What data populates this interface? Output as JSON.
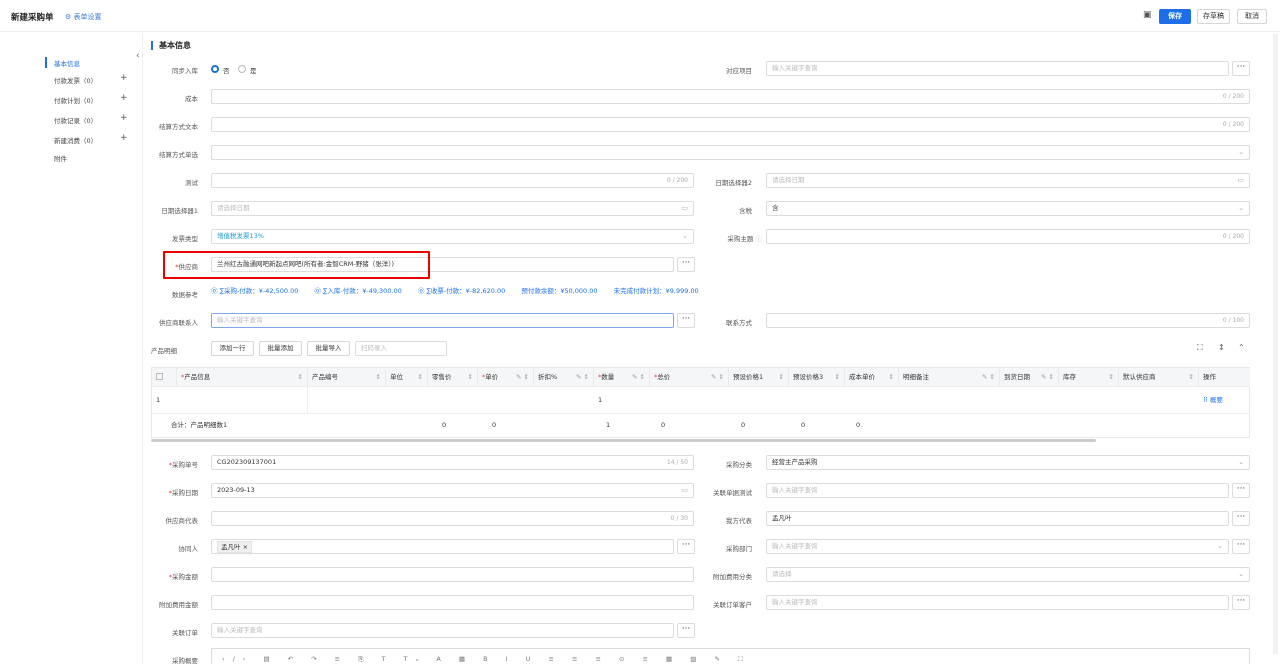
{
  "header": {
    "title": "新建采购单",
    "form_settings": "表单设置",
    "save": "保存",
    "draft": "存草稿",
    "cancel": "取消"
  },
  "sidebar": {
    "items": [
      {
        "label": "基本信息"
      },
      {
        "label": "付款发票（0）"
      },
      {
        "label": "付款计划（0）"
      },
      {
        "label": "付款记录（0）"
      },
      {
        "label": "新建消费（0）"
      },
      {
        "label": "附件"
      }
    ]
  },
  "section_title": "基本信息",
  "form": {
    "sync_label": "同步入库",
    "sync_no": "否",
    "sync_yes": "是",
    "project_label": "对应项目",
    "project_ph": "输入关键字查询",
    "cost_label": "成本",
    "cost_count": "0 / 200",
    "settle_text_label": "结算方式文本",
    "settle_text_count": "0 / 200",
    "settle_select_label": "结算方式单选",
    "test_label": "测试",
    "test_count": "0 / 200",
    "date2_label": "日期选择器2",
    "date2_ph": "请选择日期",
    "date1_label": "日期选择器1",
    "date1_ph": "请选择日期",
    "tax_label": "含税",
    "tax_value": "含",
    "invoice_label": "发票类型",
    "invoice_value": "增值税发票13%",
    "subject_label": "采购主题",
    "subject_count": "0 / 200",
    "supplier_label": "供应商",
    "supplier_value": "兰州红古融通网吧新起点网吧(所有者:金智CRM-野猪（张洋）)",
    "ref_label": "数据参考",
    "refs": [
      "⓪ ∑采购-付款：¥-42,500.00",
      "⓪ ∑入库-付款：¥-49,300.00",
      "⓪ ∑收票-付款：¥-82,620.00",
      "预付款余额：¥50,000.00",
      "未完成付款计划：¥9,999.00"
    ],
    "contact_label": "供应商联系人",
    "contact_ph": "输入关键字查询",
    "contact_way_label": "联系方式",
    "contact_way_count": "0 / 100"
  },
  "products": {
    "label": "产品明细",
    "add_row": "添加一行",
    "batch_add": "批量添加",
    "batch_import": "批量导入",
    "scan_ph": "扫码录入",
    "columns": [
      "产品信息",
      "产品编号",
      "单位",
      "零售价",
      "单价",
      "折扣%",
      "数量",
      "总价",
      "预设价格1",
      "预设价格3",
      "成本单价",
      "明细备注",
      "到货日期",
      "库存",
      "默认供应商",
      "操作"
    ],
    "row": {
      "index": "1",
      "qty": "1",
      "action": "概要"
    },
    "total": {
      "label": "合计：产品明细数1",
      "retail": "0",
      "price": "0",
      "qty": "1",
      "total": "0",
      "p1": "0",
      "p3": "0",
      "cost": "0"
    }
  },
  "lower": {
    "order_no_label": "采购单号",
    "order_no": "CG202309137001",
    "order_no_count": "14 / 50",
    "category_label": "采购分类",
    "category": "经营主产品采购",
    "date_label": "采购日期",
    "date": "2023-09-13",
    "rel_doc_label": "关联单据测试",
    "rel_doc_ph": "输入关键字查询",
    "rep_label": "供应商代表",
    "rep_count": "0 / 30",
    "our_rep_label": "我方代表",
    "our_rep": "孟凡叶",
    "collab_label": "协同人",
    "collab_tag": "孟凡叶 ×",
    "dept_label": "采购部门",
    "dept_ph": "输入关键字查询",
    "amount_label": "采购金额",
    "extra_cat_label": "附加费用分类",
    "extra_cat_ph": "请选择",
    "extra_amt_label": "附加费用金额",
    "order_cust_label": "关联订单客户",
    "order_cust_ph": "输入关键字查询",
    "rel_order_label": "关联订单",
    "rel_order_ph": "输入关键字查询",
    "summary_label": "采购概要",
    "toolbar": "‹/› ▤ ↶ ↷ ≡ ⎘ T Tₓ A ▦ B I U ≡ ≡ ≡ ⊙ ≡ ▦ ▨ ✎ ⛶"
  }
}
